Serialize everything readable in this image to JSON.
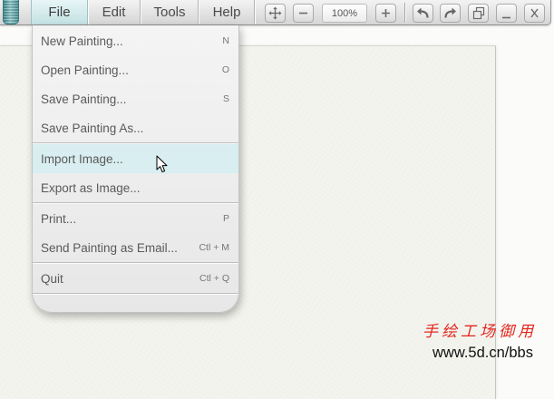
{
  "menubar": {
    "menus": [
      {
        "label": "File",
        "open": true
      },
      {
        "label": "Edit"
      },
      {
        "label": "Tools"
      },
      {
        "label": "Help"
      }
    ]
  },
  "toolbar": {
    "buttons": [
      {
        "icon": "pan-icon"
      },
      {
        "icon": "zoom-out-icon"
      },
      {
        "icon": "zoom-in-icon"
      },
      {
        "icon": "undo-icon"
      },
      {
        "icon": "redo-icon"
      },
      {
        "icon": "restore-window-icon"
      },
      {
        "icon": "minimize-icon"
      },
      {
        "icon": "close-icon"
      }
    ],
    "zoom_level": "100%"
  },
  "file_menu": {
    "groups": [
      {
        "items": [
          {
            "label": "New Painting...",
            "shortcut": "N"
          },
          {
            "label": "Open Painting...",
            "shortcut": "O"
          },
          {
            "label": "Save Painting...",
            "shortcut": "S"
          },
          {
            "label": "Save Painting As..."
          }
        ]
      },
      {
        "items": [
          {
            "label": "Import Image...",
            "hovered": true
          },
          {
            "label": "Export as Image..."
          }
        ]
      },
      {
        "items": [
          {
            "label": "Print...",
            "shortcut": "P"
          },
          {
            "label": "Send Painting as Email...",
            "shortcut": "Ctl + M"
          }
        ]
      },
      {
        "items": [
          {
            "label": "Quit",
            "shortcut": "Ctl + Q"
          }
        ]
      }
    ]
  },
  "watermark": {
    "title": "手绘工场御用",
    "url": "www.5d.cn/bbs"
  },
  "colors": {
    "accent": "#5fa5a9",
    "menu_hover": "#d8eef0",
    "watermark_red": "#e3261d"
  }
}
